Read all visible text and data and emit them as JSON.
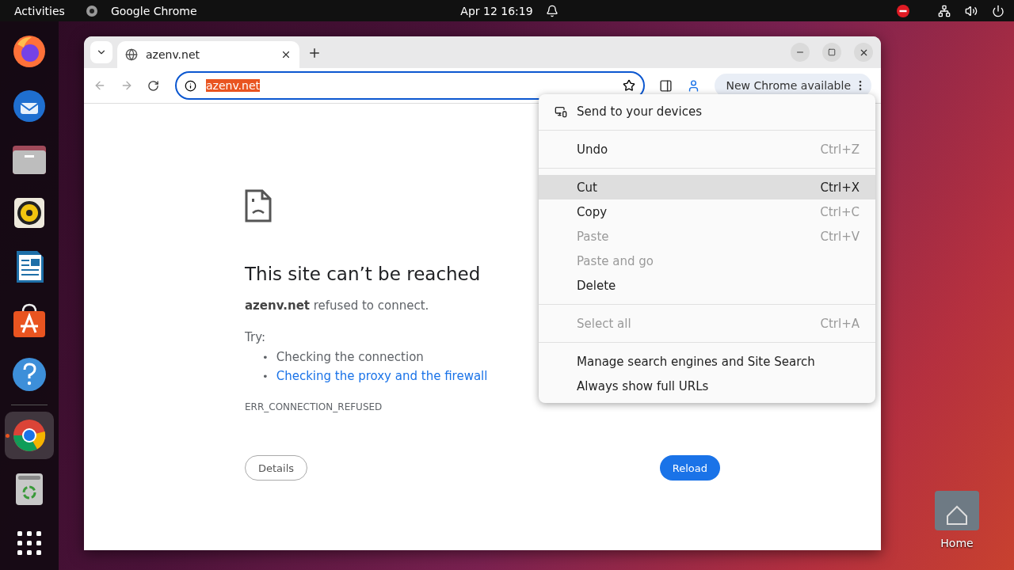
{
  "top_bar": {
    "activities": "Activities",
    "app_name": "Google Chrome",
    "clock": "Apr 12  16:19"
  },
  "dock": [
    {
      "kind": "firefox",
      "selected": false
    },
    {
      "kind": "thunderbird",
      "selected": false
    },
    {
      "kind": "files",
      "selected": false
    },
    {
      "kind": "rhythmbox",
      "selected": false
    },
    {
      "kind": "writer",
      "selected": false
    },
    {
      "kind": "appcenter",
      "selected": false
    },
    {
      "kind": "help",
      "selected": false
    },
    {
      "kind": "chrome",
      "selected": true
    },
    {
      "kind": "trash",
      "selected": false
    },
    {
      "kind": "apps",
      "selected": false
    }
  ],
  "browser": {
    "tab_title": "azenv.net",
    "address": "azenv.net",
    "update_chip": "New Chrome available"
  },
  "page": {
    "heading": "This site can’t be reached",
    "message": "**azenv.net** refused to connect.",
    "try_label": "Try:",
    "suggestions": [
      {
        "kind": "text",
        "marker": "•",
        "label": "Checking the connection"
      },
      {
        "kind": "link",
        "marker": "•",
        "label": "Checking the proxy and the firewall"
      }
    ],
    "error_code": "ERR_CONNECTION_REFUSED",
    "details_button": "Details",
    "reload_button": "Reload"
  },
  "context_menu": {
    "sections": [
      [
        {
          "label": "Send to your devices",
          "kind": "devices",
          "disabled": false,
          "selected": false
        }
      ],
      [
        {
          "label": "Undo",
          "shortcut": "Ctrl+Z",
          "kind": "plain",
          "disabled": false,
          "selected": false
        }
      ],
      [
        {
          "label": "Cut",
          "shortcut": "Ctrl+X",
          "kind": "plain",
          "disabled": false,
          "selected": true
        },
        {
          "label": "Copy",
          "shortcut": "Ctrl+C",
          "kind": "plain",
          "disabled": false,
          "selected": false
        },
        {
          "label": "Paste",
          "shortcut": "Ctrl+V",
          "kind": "plain",
          "disabled": true,
          "selected": false
        },
        {
          "label": "Paste and go",
          "kind": "plain",
          "disabled": true,
          "selected": false
        },
        {
          "label": "Delete",
          "kind": "plain",
          "disabled": false,
          "selected": false
        }
      ],
      [
        {
          "label": "Select all",
          "shortcut": "Ctrl+A",
          "kind": "plain",
          "disabled": true,
          "selected": false
        }
      ],
      [
        {
          "label": "Manage search engines and Site Search",
          "kind": "plain",
          "disabled": false,
          "selected": false
        },
        {
          "label": "Always show full URLs",
          "kind": "plain",
          "disabled": false,
          "selected": false
        }
      ]
    ]
  },
  "desktop": {
    "home_label": "Home"
  }
}
